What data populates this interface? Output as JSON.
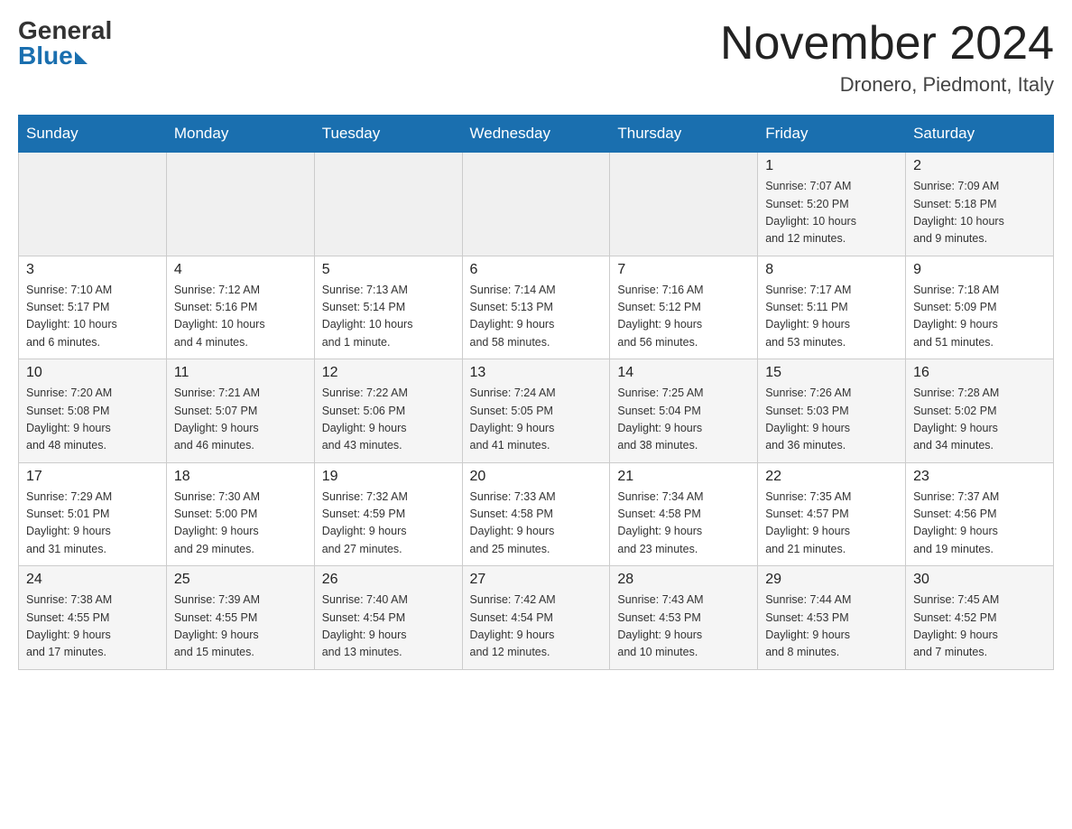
{
  "header": {
    "logo_general": "General",
    "logo_blue": "Blue",
    "month_title": "November 2024",
    "location": "Dronero, Piedmont, Italy"
  },
  "days_of_week": [
    "Sunday",
    "Monday",
    "Tuesday",
    "Wednesday",
    "Thursday",
    "Friday",
    "Saturday"
  ],
  "weeks": [
    [
      {
        "day": "",
        "info": ""
      },
      {
        "day": "",
        "info": ""
      },
      {
        "day": "",
        "info": ""
      },
      {
        "day": "",
        "info": ""
      },
      {
        "day": "",
        "info": ""
      },
      {
        "day": "1",
        "info": "Sunrise: 7:07 AM\nSunset: 5:20 PM\nDaylight: 10 hours\nand 12 minutes."
      },
      {
        "day": "2",
        "info": "Sunrise: 7:09 AM\nSunset: 5:18 PM\nDaylight: 10 hours\nand 9 minutes."
      }
    ],
    [
      {
        "day": "3",
        "info": "Sunrise: 7:10 AM\nSunset: 5:17 PM\nDaylight: 10 hours\nand 6 minutes."
      },
      {
        "day": "4",
        "info": "Sunrise: 7:12 AM\nSunset: 5:16 PM\nDaylight: 10 hours\nand 4 minutes."
      },
      {
        "day": "5",
        "info": "Sunrise: 7:13 AM\nSunset: 5:14 PM\nDaylight: 10 hours\nand 1 minute."
      },
      {
        "day": "6",
        "info": "Sunrise: 7:14 AM\nSunset: 5:13 PM\nDaylight: 9 hours\nand 58 minutes."
      },
      {
        "day": "7",
        "info": "Sunrise: 7:16 AM\nSunset: 5:12 PM\nDaylight: 9 hours\nand 56 minutes."
      },
      {
        "day": "8",
        "info": "Sunrise: 7:17 AM\nSunset: 5:11 PM\nDaylight: 9 hours\nand 53 minutes."
      },
      {
        "day": "9",
        "info": "Sunrise: 7:18 AM\nSunset: 5:09 PM\nDaylight: 9 hours\nand 51 minutes."
      }
    ],
    [
      {
        "day": "10",
        "info": "Sunrise: 7:20 AM\nSunset: 5:08 PM\nDaylight: 9 hours\nand 48 minutes."
      },
      {
        "day": "11",
        "info": "Sunrise: 7:21 AM\nSunset: 5:07 PM\nDaylight: 9 hours\nand 46 minutes."
      },
      {
        "day": "12",
        "info": "Sunrise: 7:22 AM\nSunset: 5:06 PM\nDaylight: 9 hours\nand 43 minutes."
      },
      {
        "day": "13",
        "info": "Sunrise: 7:24 AM\nSunset: 5:05 PM\nDaylight: 9 hours\nand 41 minutes."
      },
      {
        "day": "14",
        "info": "Sunrise: 7:25 AM\nSunset: 5:04 PM\nDaylight: 9 hours\nand 38 minutes."
      },
      {
        "day": "15",
        "info": "Sunrise: 7:26 AM\nSunset: 5:03 PM\nDaylight: 9 hours\nand 36 minutes."
      },
      {
        "day": "16",
        "info": "Sunrise: 7:28 AM\nSunset: 5:02 PM\nDaylight: 9 hours\nand 34 minutes."
      }
    ],
    [
      {
        "day": "17",
        "info": "Sunrise: 7:29 AM\nSunset: 5:01 PM\nDaylight: 9 hours\nand 31 minutes."
      },
      {
        "day": "18",
        "info": "Sunrise: 7:30 AM\nSunset: 5:00 PM\nDaylight: 9 hours\nand 29 minutes."
      },
      {
        "day": "19",
        "info": "Sunrise: 7:32 AM\nSunset: 4:59 PM\nDaylight: 9 hours\nand 27 minutes."
      },
      {
        "day": "20",
        "info": "Sunrise: 7:33 AM\nSunset: 4:58 PM\nDaylight: 9 hours\nand 25 minutes."
      },
      {
        "day": "21",
        "info": "Sunrise: 7:34 AM\nSunset: 4:58 PM\nDaylight: 9 hours\nand 23 minutes."
      },
      {
        "day": "22",
        "info": "Sunrise: 7:35 AM\nSunset: 4:57 PM\nDaylight: 9 hours\nand 21 minutes."
      },
      {
        "day": "23",
        "info": "Sunrise: 7:37 AM\nSunset: 4:56 PM\nDaylight: 9 hours\nand 19 minutes."
      }
    ],
    [
      {
        "day": "24",
        "info": "Sunrise: 7:38 AM\nSunset: 4:55 PM\nDaylight: 9 hours\nand 17 minutes."
      },
      {
        "day": "25",
        "info": "Sunrise: 7:39 AM\nSunset: 4:55 PM\nDaylight: 9 hours\nand 15 minutes."
      },
      {
        "day": "26",
        "info": "Sunrise: 7:40 AM\nSunset: 4:54 PM\nDaylight: 9 hours\nand 13 minutes."
      },
      {
        "day": "27",
        "info": "Sunrise: 7:42 AM\nSunset: 4:54 PM\nDaylight: 9 hours\nand 12 minutes."
      },
      {
        "day": "28",
        "info": "Sunrise: 7:43 AM\nSunset: 4:53 PM\nDaylight: 9 hours\nand 10 minutes."
      },
      {
        "day": "29",
        "info": "Sunrise: 7:44 AM\nSunset: 4:53 PM\nDaylight: 9 hours\nand 8 minutes."
      },
      {
        "day": "30",
        "info": "Sunrise: 7:45 AM\nSunset: 4:52 PM\nDaylight: 9 hours\nand 7 minutes."
      }
    ]
  ]
}
